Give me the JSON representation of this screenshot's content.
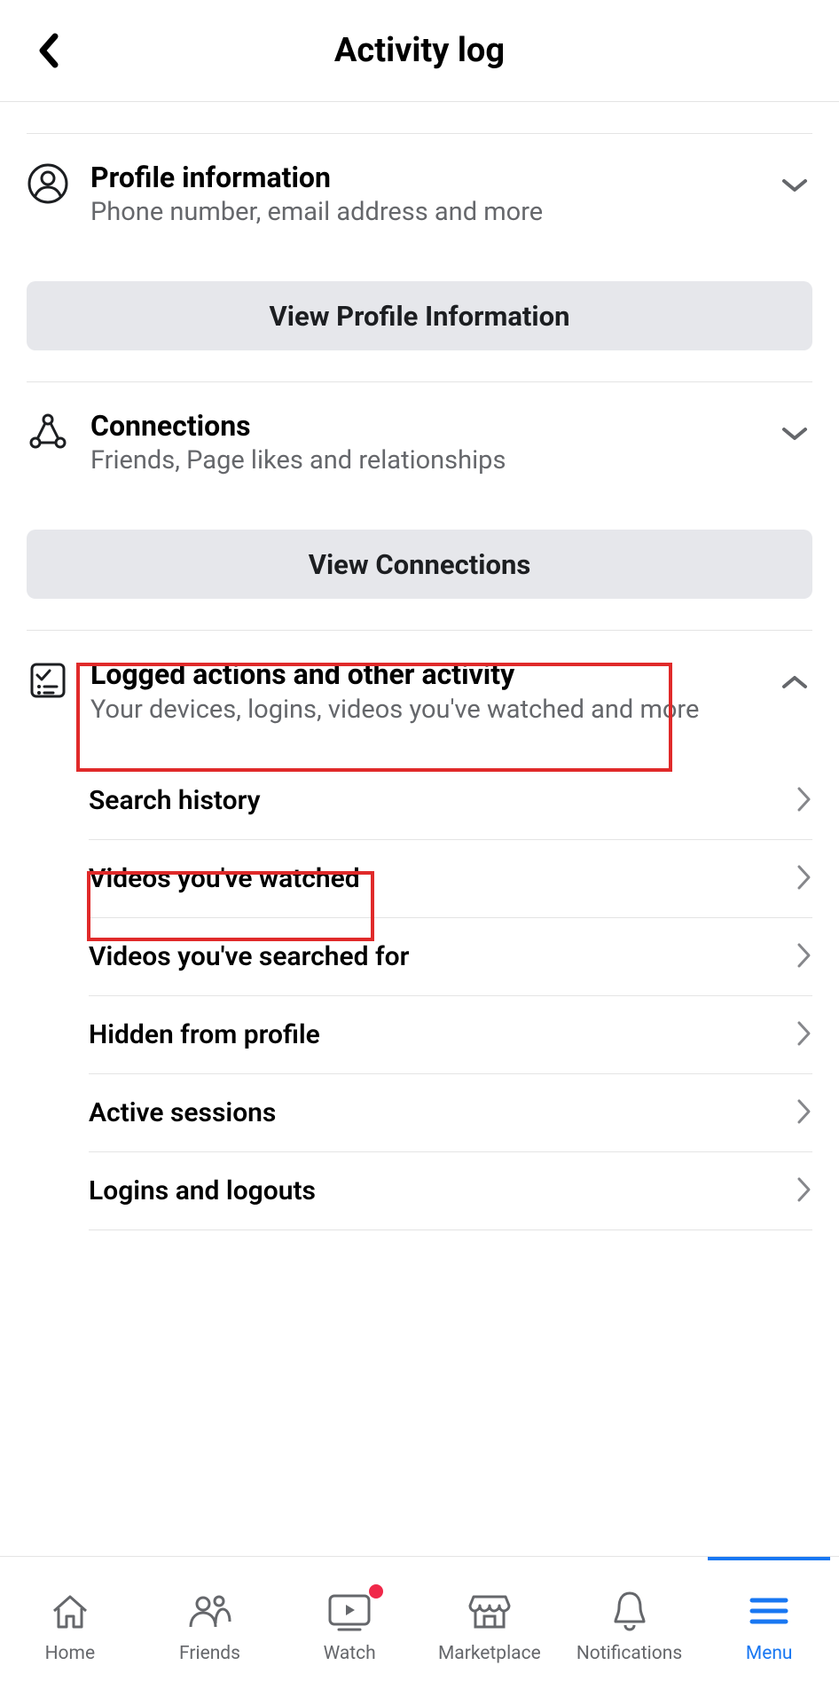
{
  "header": {
    "title": "Activity log"
  },
  "sections": {
    "profile": {
      "title": "Profile information",
      "subtitle": "Phone number, email address and more",
      "button": "View Profile Information"
    },
    "connections": {
      "title": "Connections",
      "subtitle": "Friends, Page likes and relationships",
      "button": "View Connections"
    },
    "logged": {
      "title": "Logged actions and other activity",
      "subtitle": "Your devices, logins, videos you've watched and more",
      "items": [
        "Search history",
        "Videos you've watched",
        "Videos you've searched for",
        "Hidden from profile",
        "Active sessions",
        "Logins and logouts"
      ]
    }
  },
  "tabs": {
    "home": "Home",
    "friends": "Friends",
    "watch": "Watch",
    "marketplace": "Marketplace",
    "notifications": "Notifications",
    "menu": "Menu"
  }
}
